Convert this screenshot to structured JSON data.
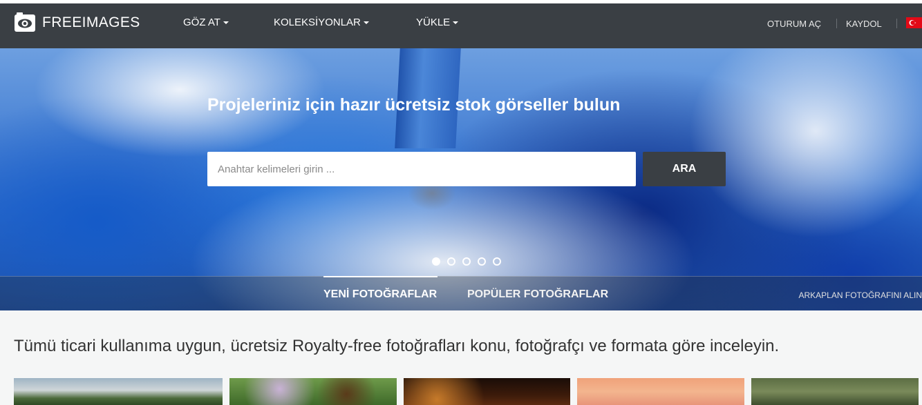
{
  "header": {
    "logo_text": "FREEIMAGES",
    "nav": [
      {
        "label": "GÖZ AT"
      },
      {
        "label": "KOLEKSİYONLAR"
      },
      {
        "label": "YÜKLE"
      }
    ],
    "login": "OTURUM AÇ",
    "signup": "KAYDOL",
    "language_flag": "turkey-flag-icon"
  },
  "hero": {
    "title": "Projeleriniz için hazır ücretsiz stok görseller bulun",
    "search_placeholder": "Anahtar kelimeleri girin ...",
    "search_value": "",
    "search_button": "ARA",
    "slides_total": 5,
    "slide_active": 1,
    "tabs": [
      {
        "label": "YENİ FOTOĞRAFLAR",
        "active": true
      },
      {
        "label": "POPÜLER FOTOĞRAFLAR",
        "active": false
      }
    ],
    "background_credit": "ARKAPLAN FOTOĞRAFINI ALIN"
  },
  "content": {
    "intro": "Tümü ticari kullanıma uygun, ücretsiz Royalty-free fotoğrafları konu, fotoğrafçı ve formata göre inceleyin."
  },
  "colors": {
    "navbar": "#3a3f44",
    "page_background": "#f5f6f6",
    "search_button": "#3a3f44"
  }
}
